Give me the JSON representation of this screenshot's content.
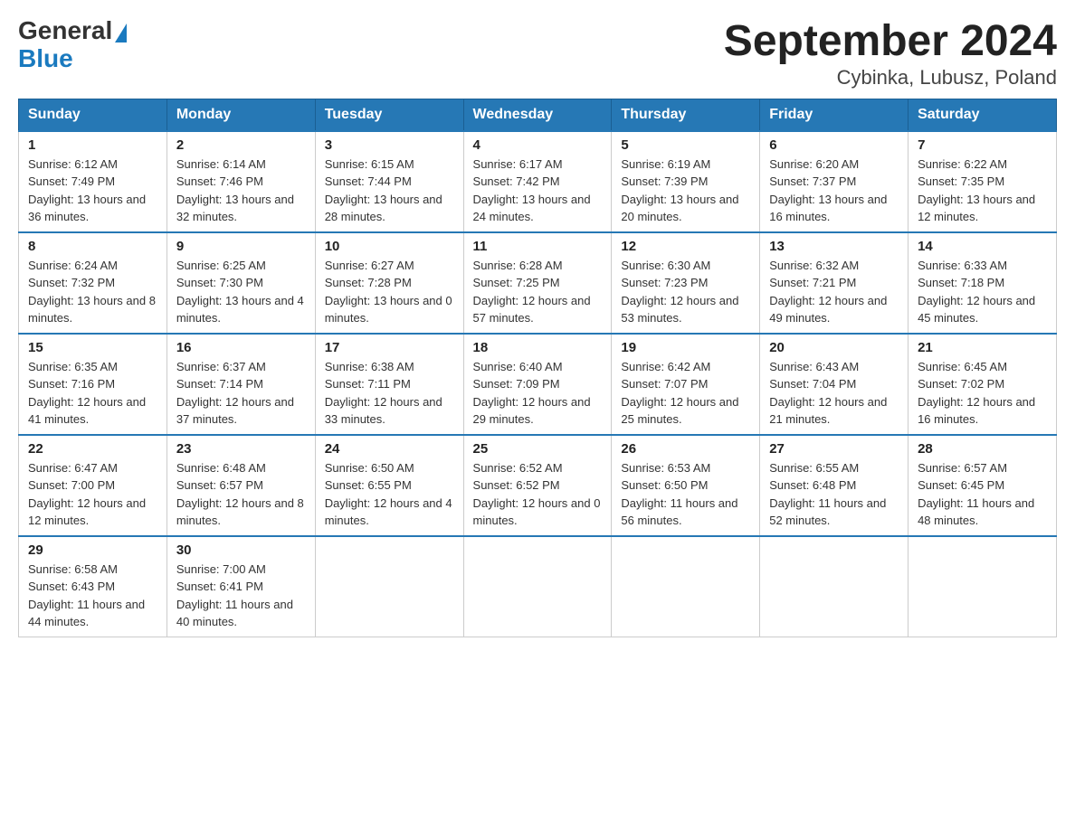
{
  "header": {
    "logo_general": "General",
    "logo_blue": "Blue",
    "title": "September 2024",
    "subtitle": "Cybinka, Lubusz, Poland"
  },
  "weekdays": [
    "Sunday",
    "Monday",
    "Tuesday",
    "Wednesday",
    "Thursday",
    "Friday",
    "Saturday"
  ],
  "days": [
    {
      "num": "1",
      "sunrise": "6:12 AM",
      "sunset": "7:49 PM",
      "daylight": "13 hours and 36 minutes."
    },
    {
      "num": "2",
      "sunrise": "6:14 AM",
      "sunset": "7:46 PM",
      "daylight": "13 hours and 32 minutes."
    },
    {
      "num": "3",
      "sunrise": "6:15 AM",
      "sunset": "7:44 PM",
      "daylight": "13 hours and 28 minutes."
    },
    {
      "num": "4",
      "sunrise": "6:17 AM",
      "sunset": "7:42 PM",
      "daylight": "13 hours and 24 minutes."
    },
    {
      "num": "5",
      "sunrise": "6:19 AM",
      "sunset": "7:39 PM",
      "daylight": "13 hours and 20 minutes."
    },
    {
      "num": "6",
      "sunrise": "6:20 AM",
      "sunset": "7:37 PM",
      "daylight": "13 hours and 16 minutes."
    },
    {
      "num": "7",
      "sunrise": "6:22 AM",
      "sunset": "7:35 PM",
      "daylight": "13 hours and 12 minutes."
    },
    {
      "num": "8",
      "sunrise": "6:24 AM",
      "sunset": "7:32 PM",
      "daylight": "13 hours and 8 minutes."
    },
    {
      "num": "9",
      "sunrise": "6:25 AM",
      "sunset": "7:30 PM",
      "daylight": "13 hours and 4 minutes."
    },
    {
      "num": "10",
      "sunrise": "6:27 AM",
      "sunset": "7:28 PM",
      "daylight": "13 hours and 0 minutes."
    },
    {
      "num": "11",
      "sunrise": "6:28 AM",
      "sunset": "7:25 PM",
      "daylight": "12 hours and 57 minutes."
    },
    {
      "num": "12",
      "sunrise": "6:30 AM",
      "sunset": "7:23 PM",
      "daylight": "12 hours and 53 minutes."
    },
    {
      "num": "13",
      "sunrise": "6:32 AM",
      "sunset": "7:21 PM",
      "daylight": "12 hours and 49 minutes."
    },
    {
      "num": "14",
      "sunrise": "6:33 AM",
      "sunset": "7:18 PM",
      "daylight": "12 hours and 45 minutes."
    },
    {
      "num": "15",
      "sunrise": "6:35 AM",
      "sunset": "7:16 PM",
      "daylight": "12 hours and 41 minutes."
    },
    {
      "num": "16",
      "sunrise": "6:37 AM",
      "sunset": "7:14 PM",
      "daylight": "12 hours and 37 minutes."
    },
    {
      "num": "17",
      "sunrise": "6:38 AM",
      "sunset": "7:11 PM",
      "daylight": "12 hours and 33 minutes."
    },
    {
      "num": "18",
      "sunrise": "6:40 AM",
      "sunset": "7:09 PM",
      "daylight": "12 hours and 29 minutes."
    },
    {
      "num": "19",
      "sunrise": "6:42 AM",
      "sunset": "7:07 PM",
      "daylight": "12 hours and 25 minutes."
    },
    {
      "num": "20",
      "sunrise": "6:43 AM",
      "sunset": "7:04 PM",
      "daylight": "12 hours and 21 minutes."
    },
    {
      "num": "21",
      "sunrise": "6:45 AM",
      "sunset": "7:02 PM",
      "daylight": "12 hours and 16 minutes."
    },
    {
      "num": "22",
      "sunrise": "6:47 AM",
      "sunset": "7:00 PM",
      "daylight": "12 hours and 12 minutes."
    },
    {
      "num": "23",
      "sunrise": "6:48 AM",
      "sunset": "6:57 PM",
      "daylight": "12 hours and 8 minutes."
    },
    {
      "num": "24",
      "sunrise": "6:50 AM",
      "sunset": "6:55 PM",
      "daylight": "12 hours and 4 minutes."
    },
    {
      "num": "25",
      "sunrise": "6:52 AM",
      "sunset": "6:52 PM",
      "daylight": "12 hours and 0 minutes."
    },
    {
      "num": "26",
      "sunrise": "6:53 AM",
      "sunset": "6:50 PM",
      "daylight": "11 hours and 56 minutes."
    },
    {
      "num": "27",
      "sunrise": "6:55 AM",
      "sunset": "6:48 PM",
      "daylight": "11 hours and 52 minutes."
    },
    {
      "num": "28",
      "sunrise": "6:57 AM",
      "sunset": "6:45 PM",
      "daylight": "11 hours and 48 minutes."
    },
    {
      "num": "29",
      "sunrise": "6:58 AM",
      "sunset": "6:43 PM",
      "daylight": "11 hours and 44 minutes."
    },
    {
      "num": "30",
      "sunrise": "7:00 AM",
      "sunset": "6:41 PM",
      "daylight": "11 hours and 40 minutes."
    }
  ]
}
